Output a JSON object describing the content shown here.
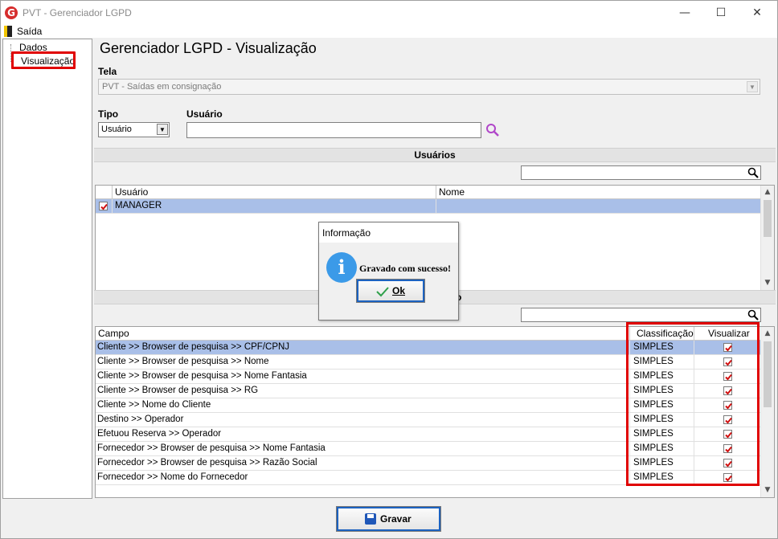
{
  "window": {
    "title": "PVT - Gerenciador LGPD",
    "app_icon_glyph": "G",
    "minimize_glyph": "—",
    "maximize_glyph": "☐",
    "close_glyph": "✕"
  },
  "menu": {
    "exit_label": "Saída"
  },
  "tree": {
    "items": [
      {
        "label": "Dados"
      },
      {
        "label": "Visualização",
        "selected": true
      }
    ]
  },
  "header": {
    "title": "Gerenciador LGPD - Visualização"
  },
  "form": {
    "tela_label": "Tela",
    "tela_value": "PVT - Saídas em consignação",
    "tipo_label": "Tipo",
    "tipo_value": "Usuário",
    "usuario_label": "Usuário",
    "usuario_value": ""
  },
  "usuarios": {
    "section_title": "Usuários",
    "columns": [
      "Usuário",
      "Nome"
    ],
    "rows": [
      {
        "checked": true,
        "usuario": "MANAGER",
        "nome": ""
      }
    ]
  },
  "campos": {
    "section_title_visible": "o",
    "columns": [
      "Campo",
      "Classificação",
      "Visualizar"
    ],
    "rows": [
      {
        "campo": "Cliente >> Browser de pesquisa >> CPF/CPNJ",
        "classificacao": "SIMPLES",
        "visualizar": true
      },
      {
        "campo": "Cliente >> Browser de pesquisa >> Nome",
        "classificacao": "SIMPLES",
        "visualizar": true
      },
      {
        "campo": "Cliente >> Browser de pesquisa >> Nome Fantasia",
        "classificacao": "SIMPLES",
        "visualizar": true
      },
      {
        "campo": "Cliente >> Browser de pesquisa >> RG",
        "classificacao": "SIMPLES",
        "visualizar": true
      },
      {
        "campo": "Cliente >> Nome do Cliente",
        "classificacao": "SIMPLES",
        "visualizar": true
      },
      {
        "campo": "Destino >> Operador",
        "classificacao": "SIMPLES",
        "visualizar": true
      },
      {
        "campo": "Efetuou Reserva >> Operador",
        "classificacao": "SIMPLES",
        "visualizar": true
      },
      {
        "campo": "Fornecedor >> Browser de pesquisa >> Nome Fantasia",
        "classificacao": "SIMPLES",
        "visualizar": true
      },
      {
        "campo": "Fornecedor >> Browser de pesquisa >> Razão Social",
        "classificacao": "SIMPLES",
        "visualizar": true
      },
      {
        "campo": "Fornecedor >> Nome do Fornecedor",
        "classificacao": "SIMPLES",
        "visualizar": true
      }
    ]
  },
  "footer": {
    "save_label": "Gravar"
  },
  "dialog": {
    "title": "Informação",
    "icon_glyph": "i",
    "message": "Gravado com sucesso!",
    "ok_label": "Ok"
  },
  "colors": {
    "selection": "#a9bfe8",
    "highlight_frame": "#e00000",
    "checkbox_red": "#d01010",
    "button_focus": "#1c62c0",
    "info_blue": "#3b9ae8"
  }
}
